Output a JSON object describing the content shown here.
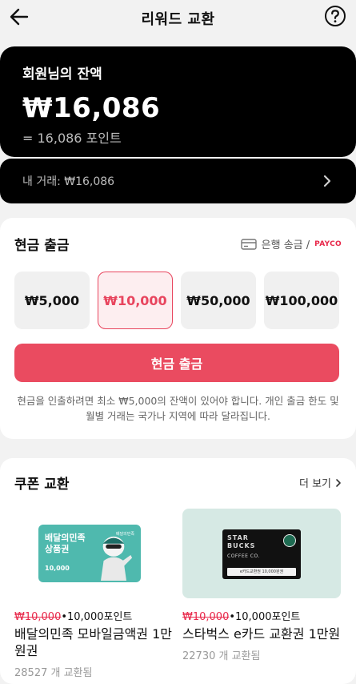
{
  "header": {
    "title": "리워드 교환"
  },
  "balance": {
    "label": "회원님의 잔액",
    "amount": "₩16,086",
    "points": "= 16,086 포인트"
  },
  "history": {
    "label": "내 거래: ₩16,086"
  },
  "cash_withdrawal": {
    "title": "현금 출금",
    "method_bank": "은행 송금 /",
    "method_payco": "PAYCO",
    "amounts": [
      "₩5,000",
      "₩10,000",
      "₩50,000",
      "₩100,000"
    ],
    "selected_index": 1,
    "button_label": "현금 출금",
    "notice": "현금을 인출하려면 최소 ₩5,000의 잔액이 있어야 합니다. 개인 출금 한도 및 월별 거래는 국가나 지역에 따라 달라집니다."
  },
  "coupons": {
    "title": "쿠폰 교환",
    "more_label": "더 보기",
    "items": [
      {
        "original_price": "₩10,000",
        "points_price": "•10,000포인트",
        "name": "배달의민족 모바일금액권 1만원권",
        "count": "28527 개 교환됨",
        "card_title_1": "배달의민족",
        "card_title_2": "상품권",
        "card_value": "10,000",
        "card_brand": "배달의민족"
      },
      {
        "original_price": "₩10,000",
        "points_price": "•10,000포인트",
        "name": "스타벅스 e카드 교환권 1만원",
        "count": "22730 개 교환됨",
        "card_word_1": "STAR",
        "card_word_2": "BUCKS",
        "card_word_3": "COFFEE CO.",
        "card_strip": "e카드교환권 10,000원권"
      }
    ]
  },
  "colors": {
    "accent": "#ea4b60",
    "payco": "#e8284a",
    "dark_card": "#000000"
  }
}
